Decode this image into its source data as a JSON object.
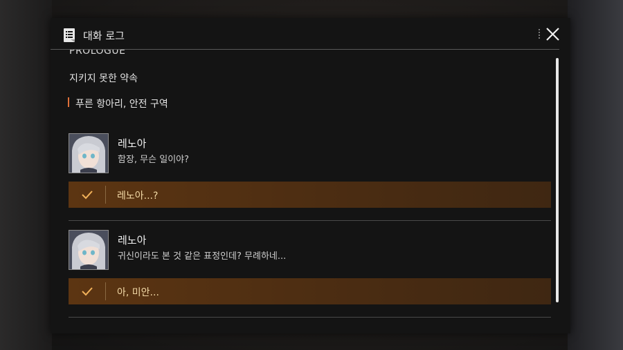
{
  "header": {
    "title": "대화 로그",
    "icon": "log-document-icon",
    "close_icon": "close-icon"
  },
  "log": {
    "chapter": "PROLOGUE",
    "episode": "지키지 못한 약속",
    "location": "푸른 항아리, 안전 구역",
    "entries": [
      {
        "speaker": "레노아",
        "text": "함장, 무슨 일이야?",
        "choice": "레노아...?"
      },
      {
        "speaker": "레노아",
        "text": "귀신이라도 본 것 같은 표정인데? 무례하네...",
        "choice": "아, 미안..."
      }
    ]
  },
  "colors": {
    "accent": "#e0703a",
    "choice_bg": "#5c3512",
    "choice_text": "#f2d9a6"
  }
}
